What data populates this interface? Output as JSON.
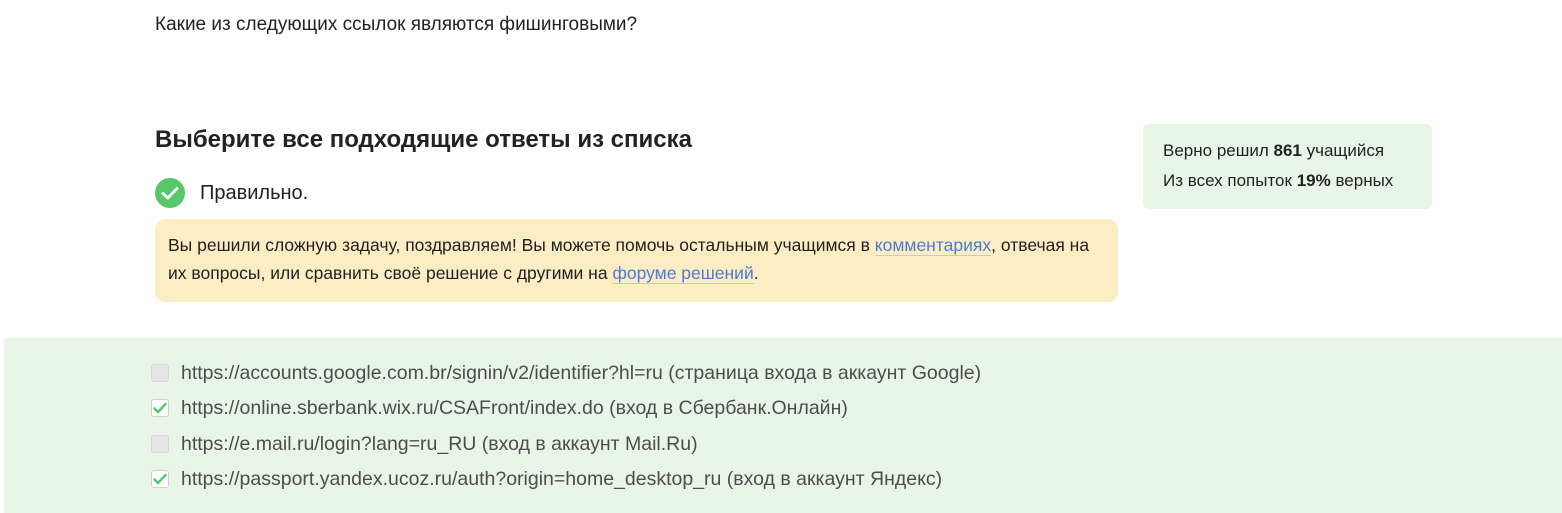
{
  "question": "Какие из следующих ссылок являются фишинговыми?",
  "instructions": "Выберите все подходящие ответы из списка",
  "status": {
    "text": "Правильно.",
    "state": "correct",
    "color": "#57c768"
  },
  "feedback": {
    "part1": "Вы решили сложную задачу, поздравляем! Вы можете помочь остальным учащимся в ",
    "link1": "комментариях",
    "part2": ", отвечая на их вопросы, или сравнить своё решение с другими на ",
    "link2": "форуме решений",
    "part3": "."
  },
  "stats": {
    "line1_prefix": "Верно решил ",
    "solved_count": "861",
    "line1_suffix": " учащийся",
    "line2_prefix": "Из всех попыток ",
    "percent": "19%",
    "line2_suffix": " верных"
  },
  "options": [
    {
      "label": "https://accounts.google.com.br/signin/v2/identifier?hl=ru (страница входа в аккаунт Google)",
      "checked": false
    },
    {
      "label": "https://online.sberbank.wix.ru/CSAFront/index.do (вход в Сбербанк.Онлайн)",
      "checked": true
    },
    {
      "label": "https://e.mail.ru/login?lang=ru_RU (вход в аккаунт Mail.Ru)",
      "checked": false
    },
    {
      "label": "https://passport.yandex.ucoz.ru/auth?origin=home_desktop_ru (вход в аккаунт Яндекс)",
      "checked": true
    }
  ],
  "colors": {
    "accent_green": "#57c768",
    "feedback_bg": "#fdedc5",
    "answers_bg": "#e8f6e8",
    "link": "#4a7cd6"
  }
}
